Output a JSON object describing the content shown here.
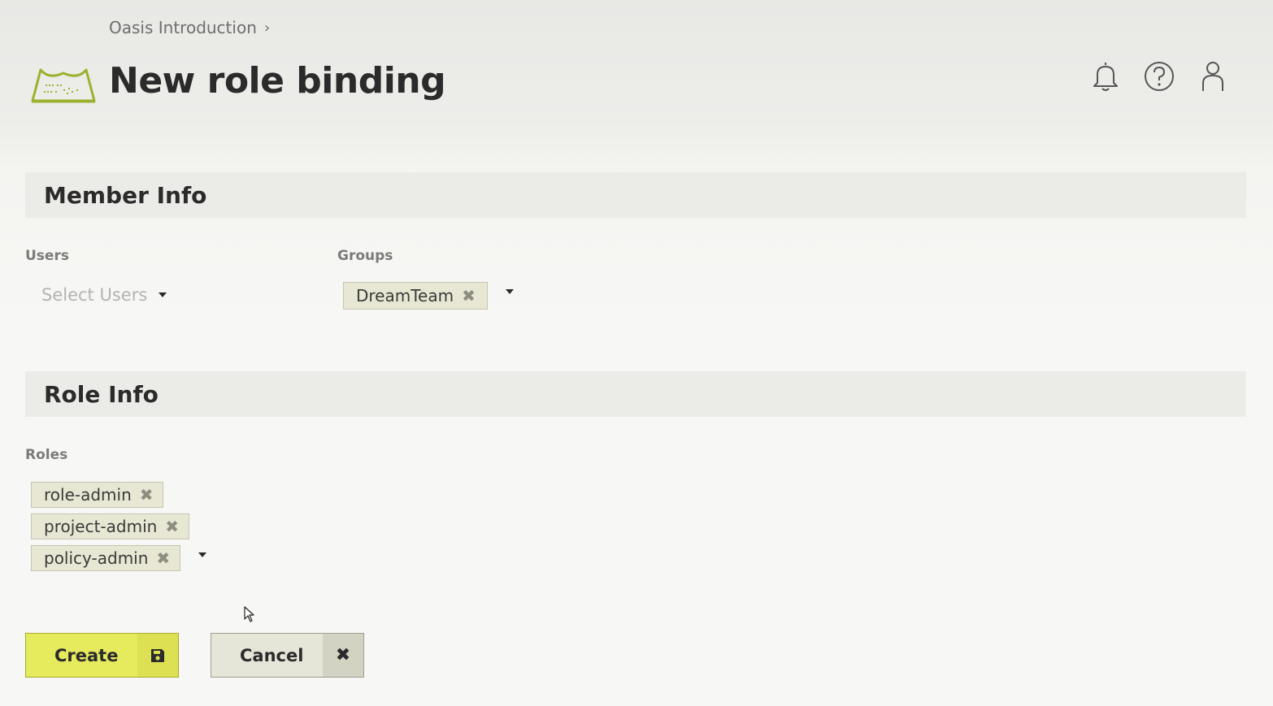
{
  "breadcrumb": {
    "items": [
      "Oasis Introduction"
    ]
  },
  "header": {
    "title": "New role binding",
    "icons": [
      "bell-icon",
      "help-icon",
      "user-icon"
    ]
  },
  "member_info": {
    "section_title": "Member Info",
    "users": {
      "label": "Users",
      "placeholder": "Select Users",
      "selected": []
    },
    "groups": {
      "label": "Groups",
      "selected": [
        "DreamTeam"
      ]
    }
  },
  "role_info": {
    "section_title": "Role Info",
    "roles": {
      "label": "Roles",
      "selected": [
        "role-admin",
        "project-admin",
        "policy-admin"
      ]
    }
  },
  "actions": {
    "create_label": "Create",
    "cancel_label": "Cancel"
  },
  "colors": {
    "accent": "#e6ea5d",
    "tag_bg": "#e7e7d3",
    "logo": "#9ab22e"
  }
}
